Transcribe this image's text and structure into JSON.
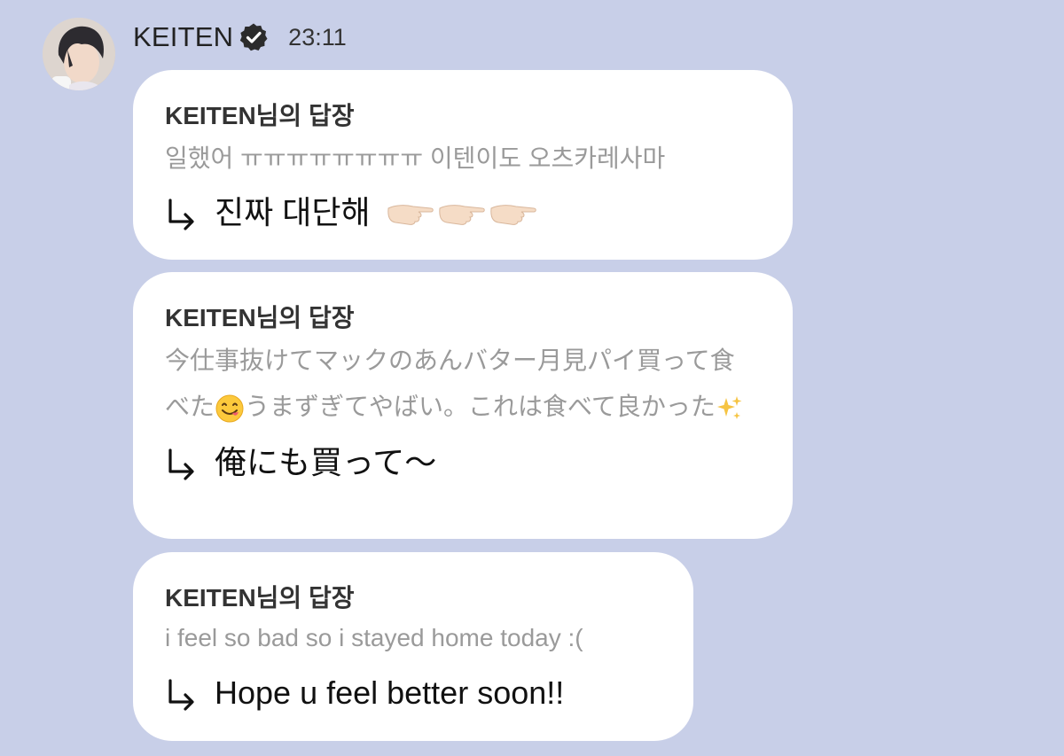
{
  "header": {
    "sender": "KEITEN",
    "time": "23:11",
    "avatar_icon": "profile-photo",
    "verified_icon": "verified-badge-icon"
  },
  "messages": [
    {
      "reply_title": "KEITEN님의 답장",
      "quoted": "일했어 ㅠㅠㅠㅠㅠㅠㅠㅠ 이텐이도 오츠카레사마",
      "reply": "진짜 대단해",
      "reply_emoji": [
        "pointing-hand-icon",
        "pointing-hand-icon",
        "pointing-hand-icon"
      ]
    },
    {
      "reply_title": "KEITEN님의 답장",
      "quoted_part1": "今仕事抜けてマックのあんバター月見パイ買って食べた",
      "quoted_emoji1": "yum-face-icon",
      "quoted_part2": "うまずぎてやばい。これは食べて良かった",
      "quoted_emoji2": "sparkles-icon",
      "reply": "俺にも買って〜"
    },
    {
      "reply_title": "KEITEN님의 답장",
      "quoted": "i feel so bad so i stayed home today :(",
      "reply": "Hope u feel better soon!!"
    }
  ],
  "colors": {
    "background": "#c8cfe8",
    "bubble": "#ffffff",
    "quoted_text": "#9a9a9a",
    "reply_text": "#111111"
  }
}
